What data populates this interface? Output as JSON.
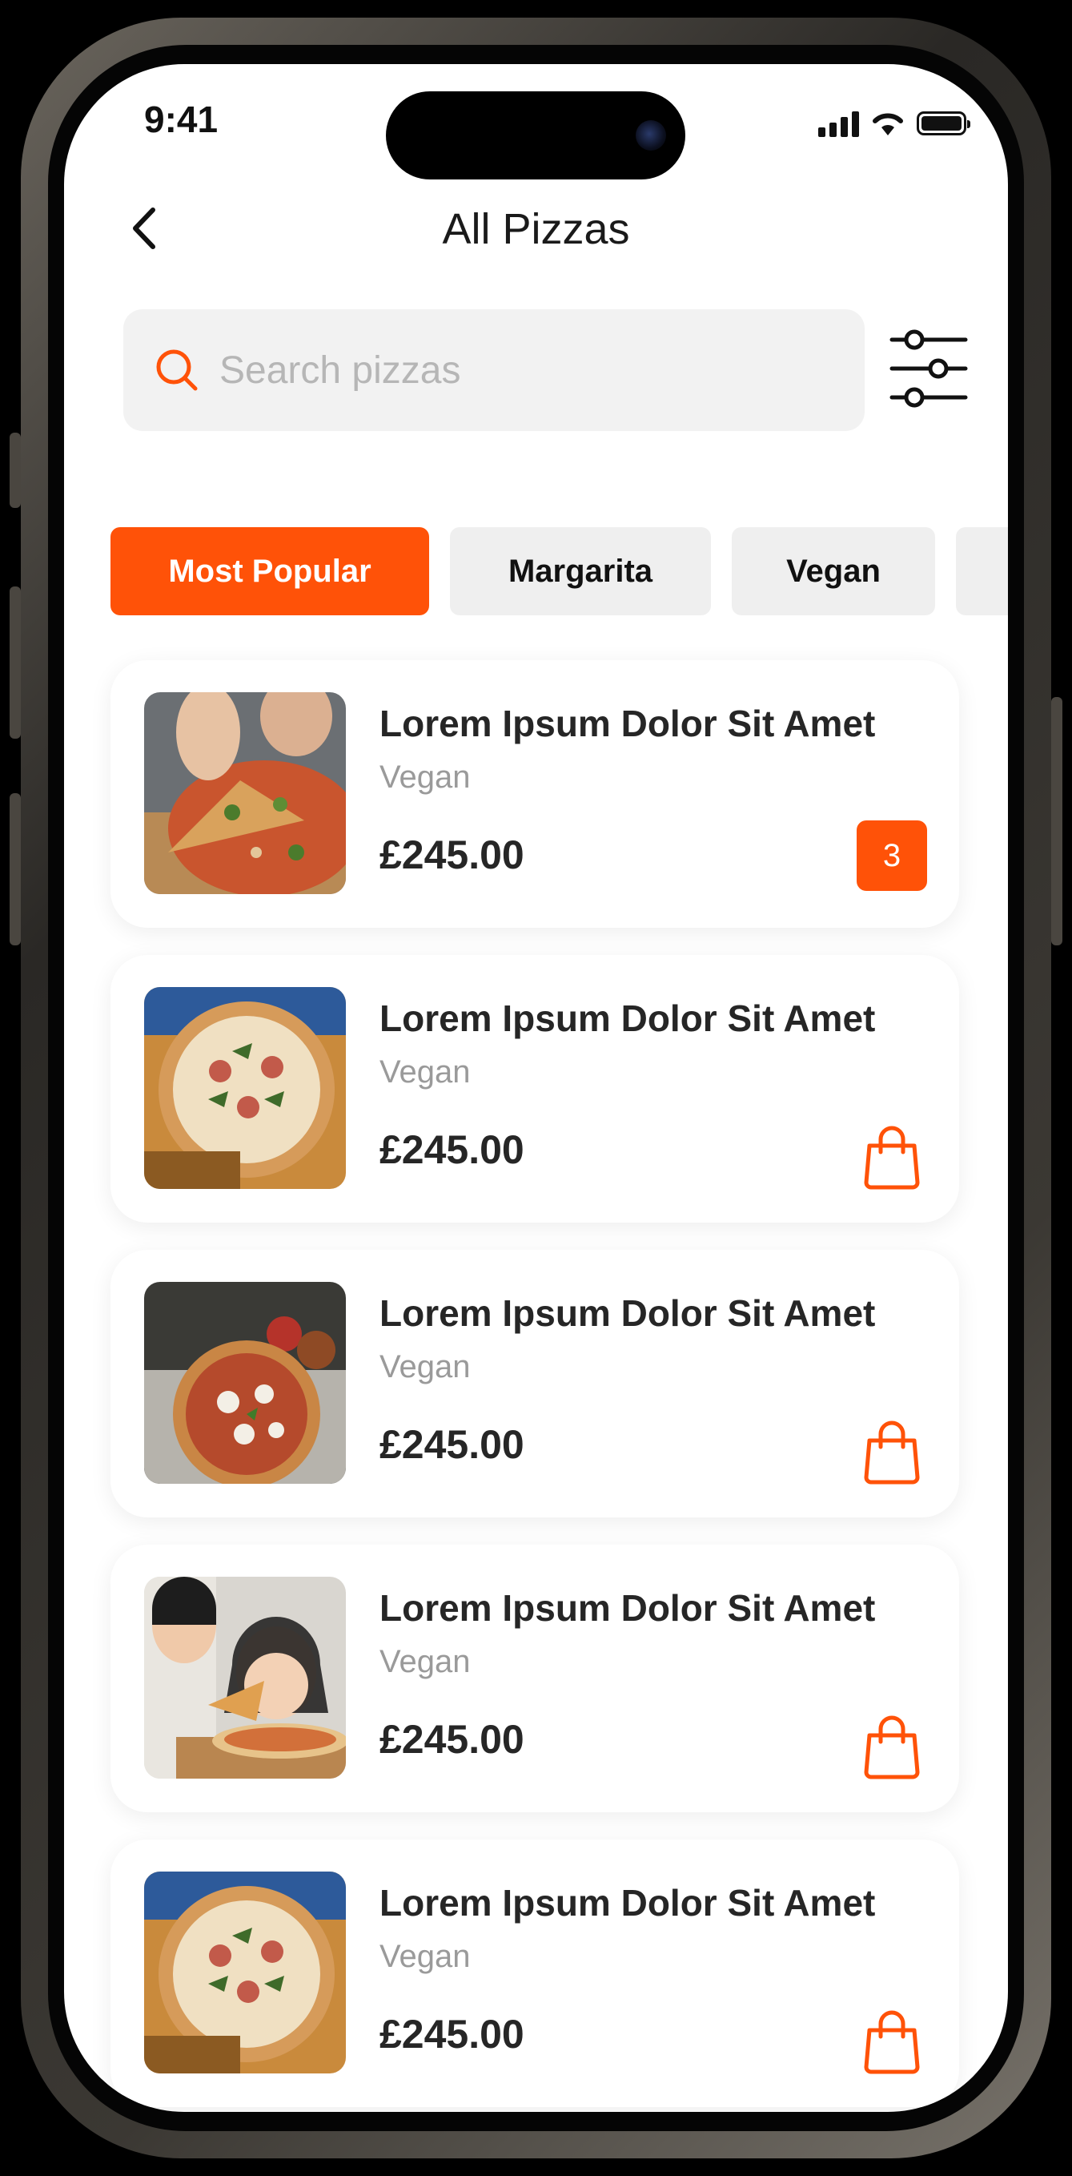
{
  "status_bar": {
    "time": "9:41"
  },
  "header": {
    "title": "All Pizzas"
  },
  "search": {
    "placeholder": "Search pizzas",
    "value": ""
  },
  "categories": [
    {
      "label": "Most Popular",
      "active": true
    },
    {
      "label": "Margarita",
      "active": false
    },
    {
      "label": "Vegan",
      "active": false
    }
  ],
  "products": [
    {
      "name": "Lorem Ipsum Dolor Sit Amet",
      "category": "Vegan",
      "price": "£245.00",
      "cart_qty": "3"
    },
    {
      "name": "Lorem Ipsum Dolor Sit Amet",
      "category": "Vegan",
      "price": "£245.00"
    },
    {
      "name": "Lorem Ipsum Dolor Sit Amet",
      "category": "Vegan",
      "price": "£245.00"
    },
    {
      "name": "Lorem Ipsum Dolor Sit Amet",
      "category": "Vegan",
      "price": "£245.00"
    },
    {
      "name": "Lorem Ipsum Dolor Sit Amet",
      "category": "Vegan",
      "price": "£245.00"
    }
  ],
  "colors": {
    "accent": "#ff5208",
    "chip_bg": "#efefef",
    "search_bg": "#f2f2f2",
    "muted_text": "#9a9a9a"
  },
  "icons": {
    "back": "chevron-left-icon",
    "search": "search-icon",
    "filter": "sliders-icon",
    "cart": "shopping-bag-icon"
  }
}
